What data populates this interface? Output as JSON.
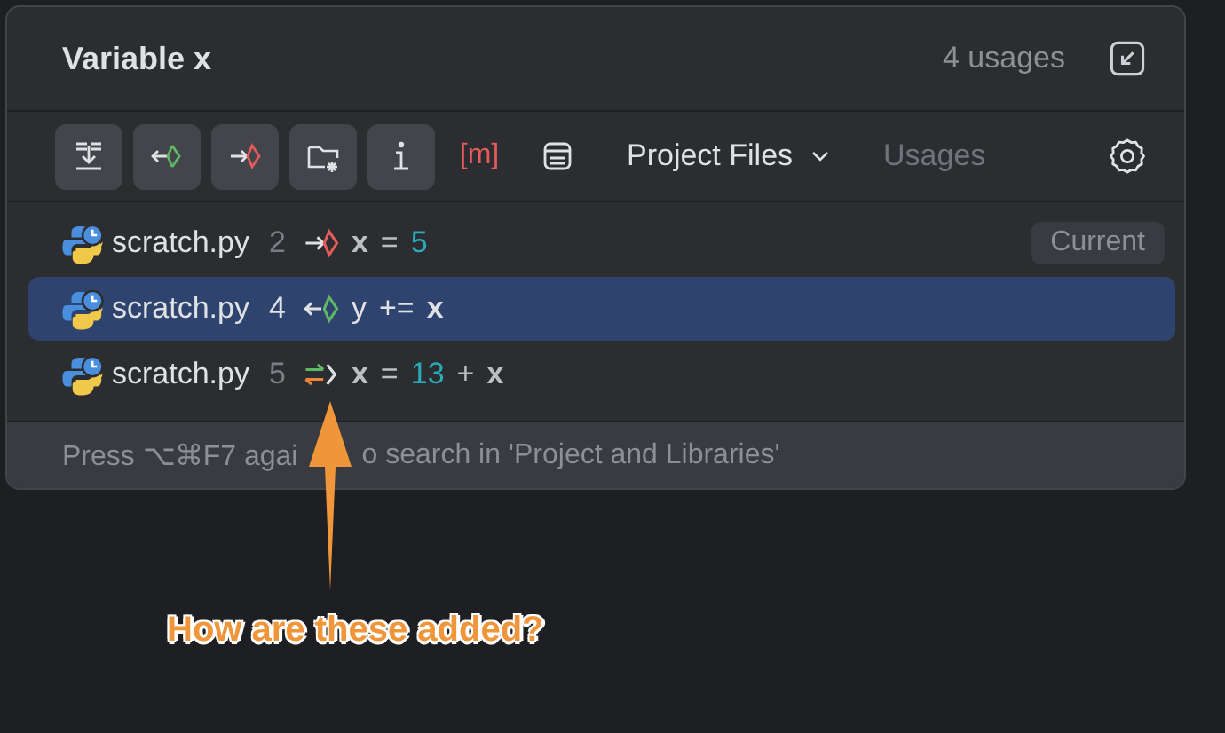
{
  "popup": {
    "title": "Variable x",
    "usage_count": "4 usages"
  },
  "toolbar": [
    {
      "kind": "merge",
      "on": true
    },
    {
      "kind": "read",
      "on": true
    },
    {
      "kind": "write",
      "on": true
    },
    {
      "kind": "folder",
      "on": true
    },
    {
      "kind": "info",
      "on": true
    },
    {
      "kind": "text",
      "label": "[m]",
      "on": false
    },
    {
      "kind": "list",
      "on": false
    }
  ],
  "scope": {
    "label": "Project Files"
  },
  "usages_label": "Usages",
  "rows": [
    {
      "file": "scratch.py",
      "line": "2",
      "kind": "write",
      "selected": false,
      "tag": "Current",
      "code": [
        {
          "kind": "var",
          "text": "x"
        },
        {
          "kind": "op",
          "text": "="
        },
        {
          "kind": "num",
          "text": "5"
        }
      ]
    },
    {
      "file": "scratch.py",
      "line": "4",
      "kind": "read",
      "selected": true,
      "code": [
        {
          "kind": "plain",
          "text": "y"
        },
        {
          "kind": "op",
          "text": "+="
        },
        {
          "kind": "var",
          "text": "x"
        }
      ]
    },
    {
      "file": "scratch.py",
      "line": "5",
      "kind": "readwrite",
      "selected": false,
      "code": [
        {
          "kind": "var",
          "text": "x"
        },
        {
          "kind": "op",
          "text": "="
        },
        {
          "kind": "num",
          "text": "13"
        },
        {
          "kind": "op",
          "text": "+"
        },
        {
          "kind": "var",
          "text": "x"
        }
      ]
    }
  ],
  "footer": {
    "parts": [
      "Press ⌥⌘F7 agai",
      "o search in 'Project and Libraries'"
    ]
  },
  "annotation": {
    "text": "How are these added?"
  }
}
